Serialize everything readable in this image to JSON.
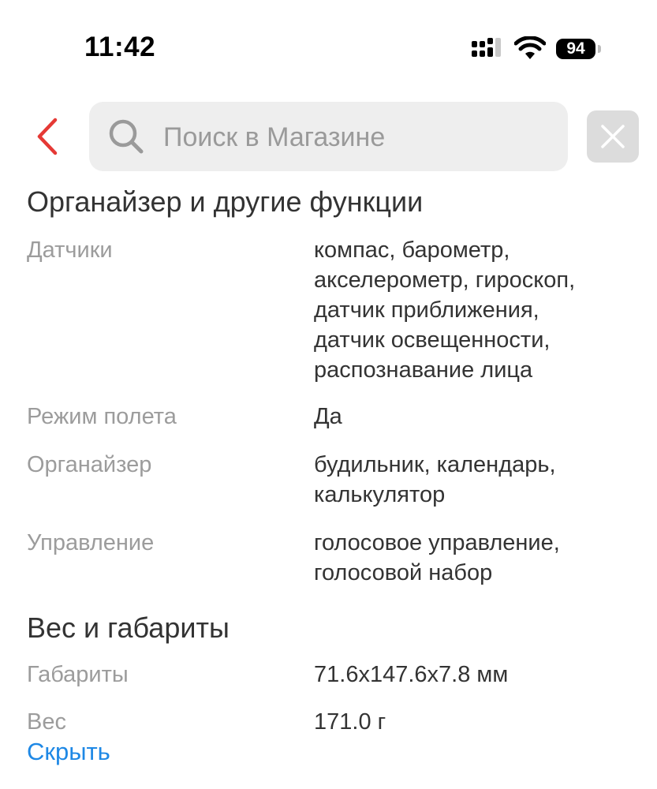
{
  "status_bar": {
    "time": "11:42",
    "battery_level": "94",
    "icons": [
      "cellular-signal-icon",
      "wifi-icon",
      "battery-icon"
    ]
  },
  "search": {
    "placeholder": "Поиск в Магазине",
    "value": ""
  },
  "colors": {
    "accent_red": "#e53935",
    "link_blue": "#1e88e5",
    "label_gray": "#9c9c9c"
  },
  "sections": [
    {
      "title": "Органайзер и другие функции",
      "rows": [
        {
          "label": "Датчики",
          "value_lines": [
            "компас, барометр,",
            "акселерометр, гироскоп,",
            "датчик приближения,",
            "датчик освещенности,",
            "распознавание лица"
          ]
        },
        {
          "label": "Режим полета",
          "value_lines": [
            "Да"
          ]
        },
        {
          "label": "Органайзер",
          "value_lines": [
            "будильник, календарь,",
            "калькулятор"
          ]
        },
        {
          "label": "Управление",
          "value_lines": [
            "голосовое управление,",
            "голосовой набор"
          ]
        }
      ]
    },
    {
      "title": "Вес и габариты",
      "rows": [
        {
          "label": "Габариты",
          "value_lines": [
            "71.6x147.6x7.8 мм"
          ]
        },
        {
          "label": "Вес",
          "value_lines": [
            "171.0 г"
          ]
        }
      ]
    }
  ],
  "hide_link": "Скрыть"
}
